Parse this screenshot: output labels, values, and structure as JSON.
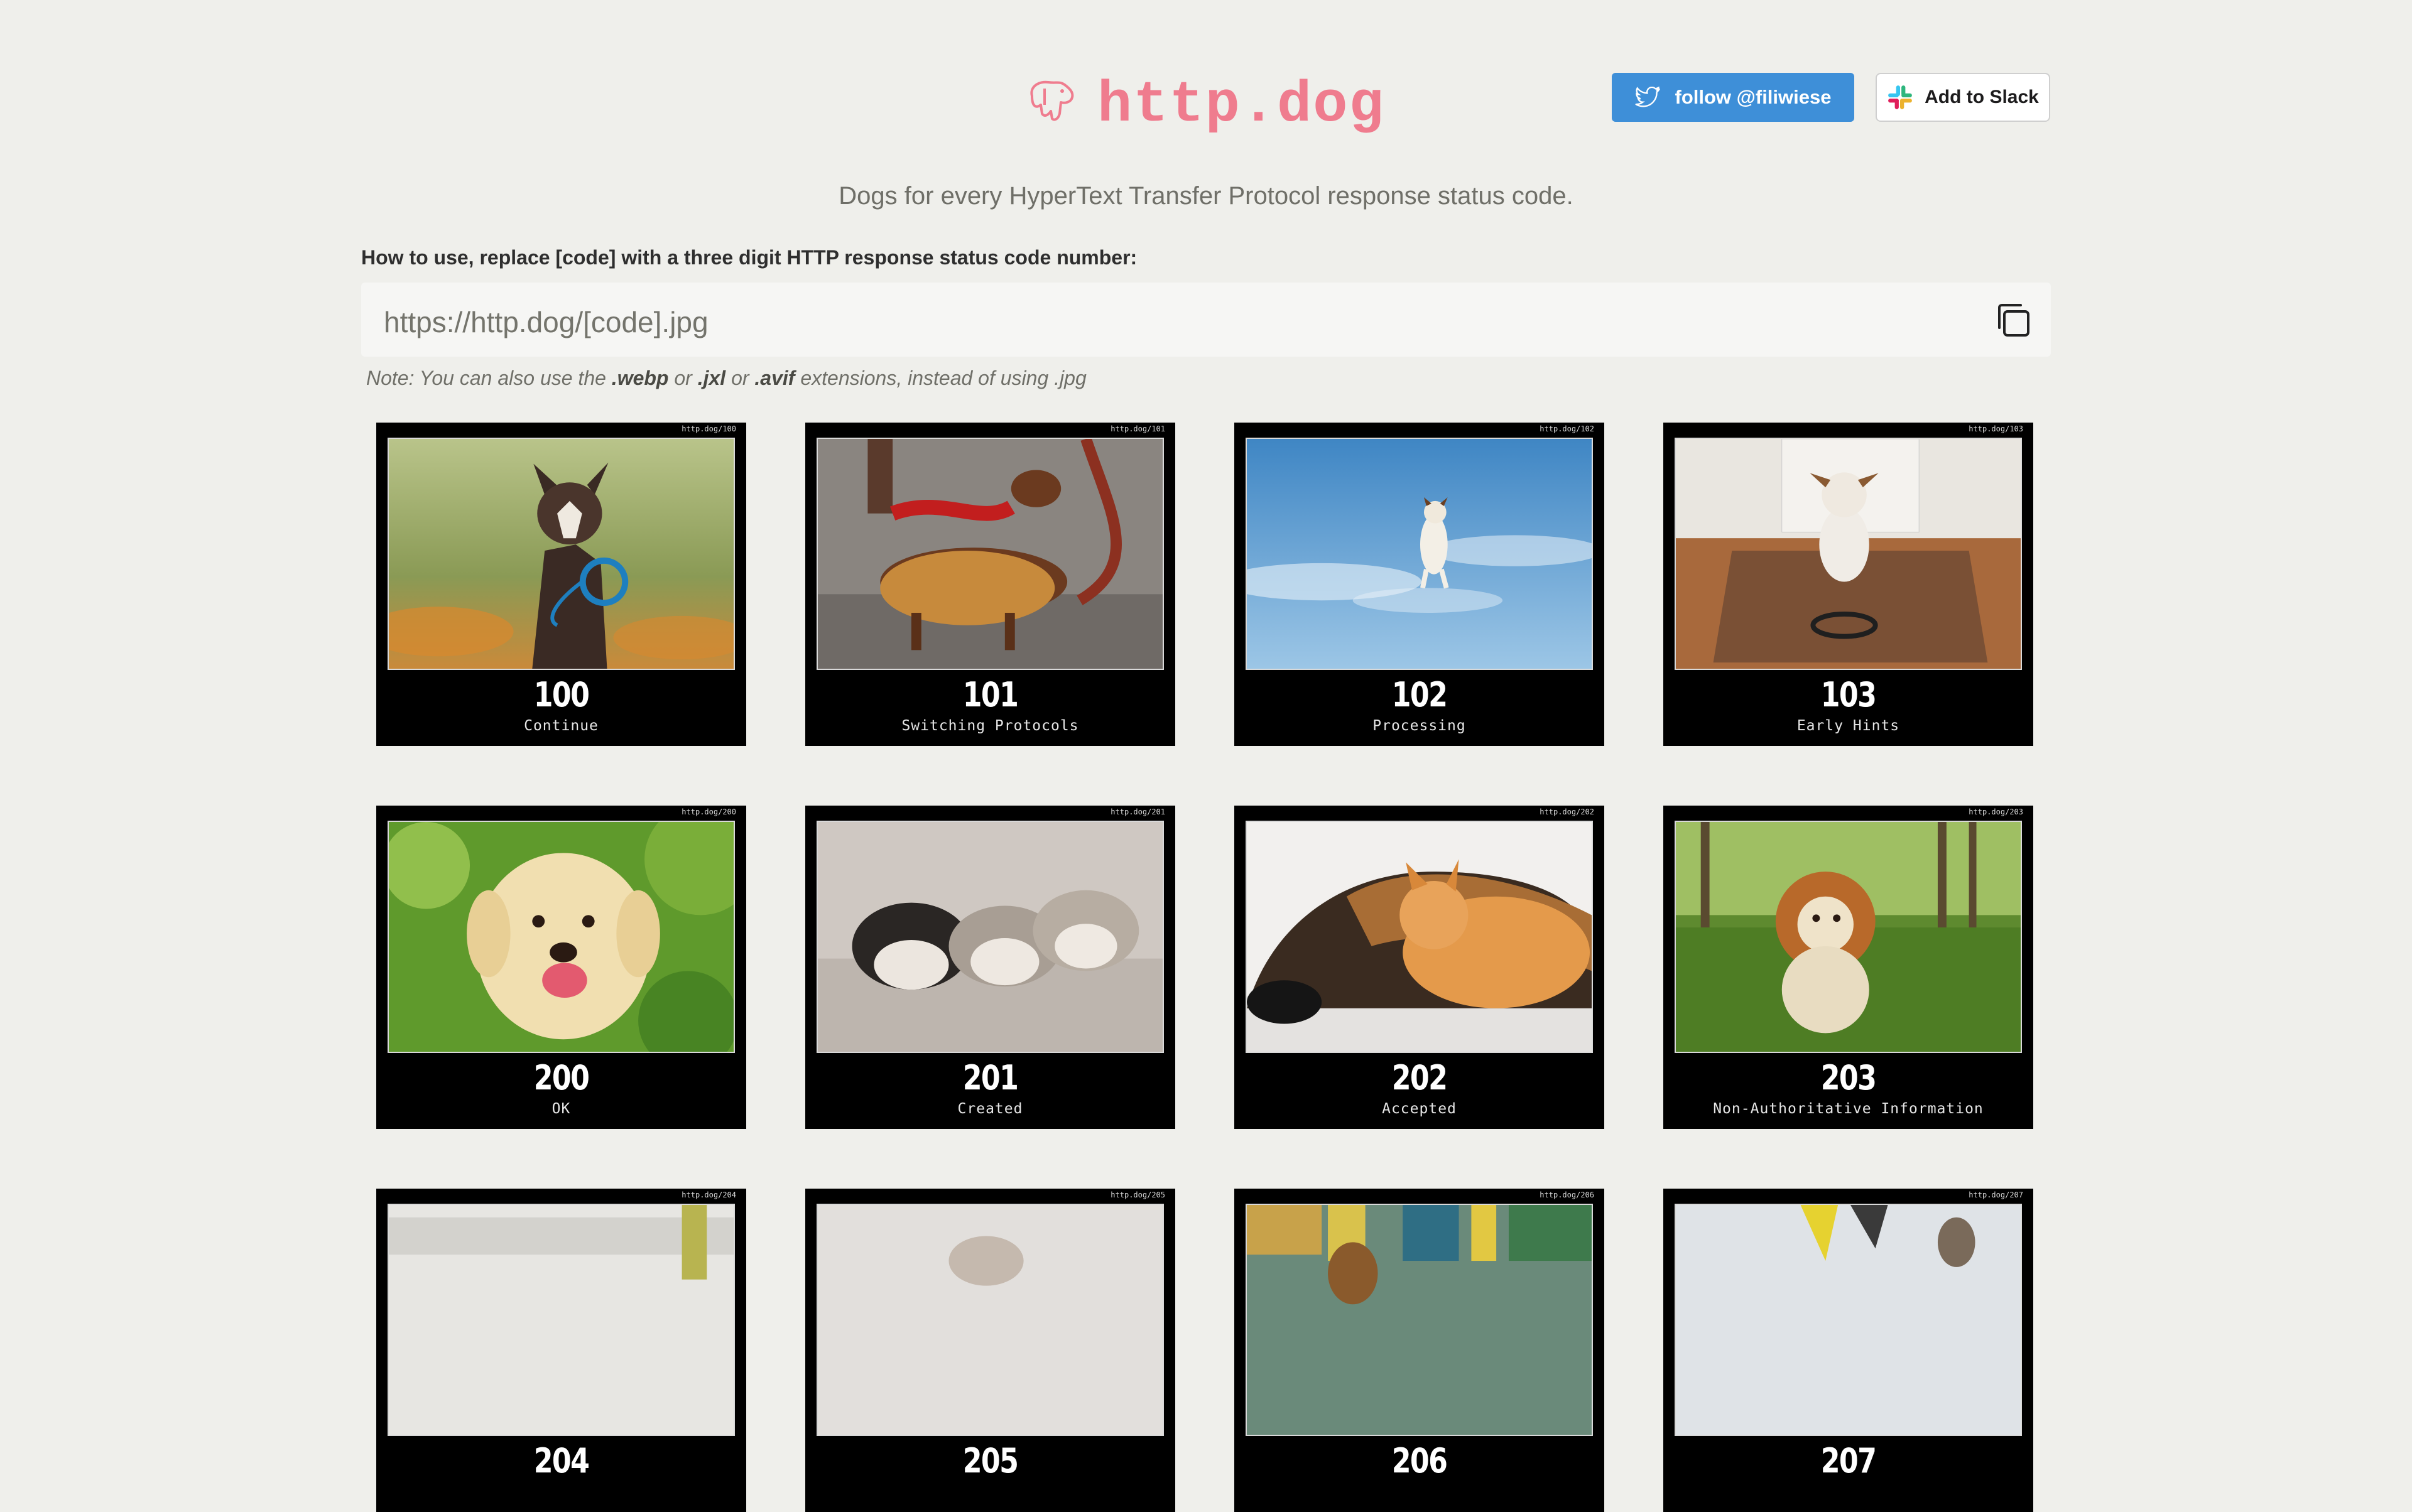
{
  "header": {
    "logo_text": "http.dog",
    "twitter_label": "follow @filiwiese",
    "slack_label": "Add to Slack"
  },
  "tagline": "Dogs for every HyperText Transfer Protocol response status code.",
  "howto": "How to use, replace [code] with a three digit HTTP response status code number:",
  "url_template": "https://http.dog/[code].jpg",
  "note": {
    "prefix": "Note: You can also use the ",
    "ext1": ".webp",
    "or1": " or ",
    "ext2": ".jxl",
    "or2": " or ",
    "ext3": ".avif",
    "suffix": " extensions, instead of using .jpg"
  },
  "colors": {
    "background": "#efefeb",
    "logo": "#ef7c8e",
    "twitter": "#3e8fd8",
    "card": "#000000"
  },
  "cards": [
    {
      "code": "100",
      "label": "Continue",
      "url": "http.dog/100",
      "scene": "collie-autumn"
    },
    {
      "code": "101",
      "label": "Switching Protocols",
      "url": "http.dog/101",
      "scene": "dachshund-hotdog"
    },
    {
      "code": "102",
      "label": "Processing",
      "url": "http.dog/102",
      "scene": "dog-jumping-sky"
    },
    {
      "code": "103",
      "label": "Early Hints",
      "url": "http.dog/103",
      "scene": "terrier-doormat"
    },
    {
      "code": "200",
      "label": "OK",
      "url": "http.dog/200",
      "scene": "lab-puppy-green"
    },
    {
      "code": "201",
      "label": "Created",
      "url": "http.dog/201",
      "scene": "husky-puppies"
    },
    {
      "code": "202",
      "label": "Accepted",
      "url": "http.dog/202",
      "scene": "shepherd-and-cat"
    },
    {
      "code": "203",
      "label": "Non-Authoritative Information",
      "url": "http.dog/203",
      "scene": "dog-lion-mane"
    },
    {
      "code": "204",
      "label": "",
      "url": "http.dog/204",
      "scene": "kitchen"
    },
    {
      "code": "205",
      "label": "",
      "url": "http.dog/205",
      "scene": "blurred-white"
    },
    {
      "code": "206",
      "label": "",
      "url": "http.dog/206",
      "scene": "street-market"
    },
    {
      "code": "207",
      "label": "",
      "url": "http.dog/207",
      "scene": "snow-bike"
    }
  ]
}
